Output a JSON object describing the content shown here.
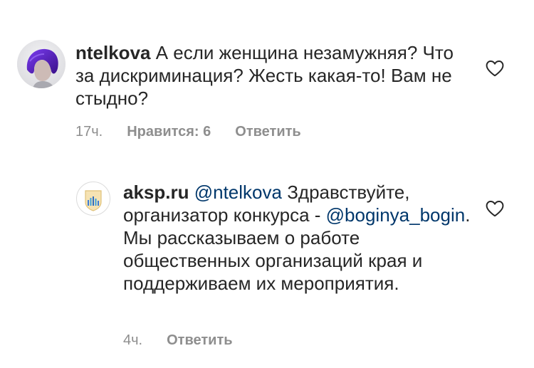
{
  "comments": [
    {
      "username": "ntelkova",
      "text": "А если женщина незамужняя? Что за дискриминация? Жесть какая-то! Вам не стыдно?",
      "time": "17ч.",
      "likes": "Нравится: 6",
      "reply": "Ответить"
    },
    {
      "username": "aksp.ru",
      "mention_1": "@ntelkova",
      "text_1": "Здравствуйте, организатор конкурса -",
      "mention_2": "@boginya_bogin",
      "text_2": ". Мы рассказываем о работе общественных организаций края и поддерживаем их мероприятия.",
      "time": "4ч.",
      "reply": "Ответить"
    }
  ],
  "icons": {
    "like": "heart-outline-icon",
    "avatar_1": "user-avatar-purple-hair",
    "avatar_2": "aksp-logo"
  },
  "colors": {
    "text": "#262626",
    "secondary": "#8e8e8e",
    "mention": "#00376b"
  }
}
